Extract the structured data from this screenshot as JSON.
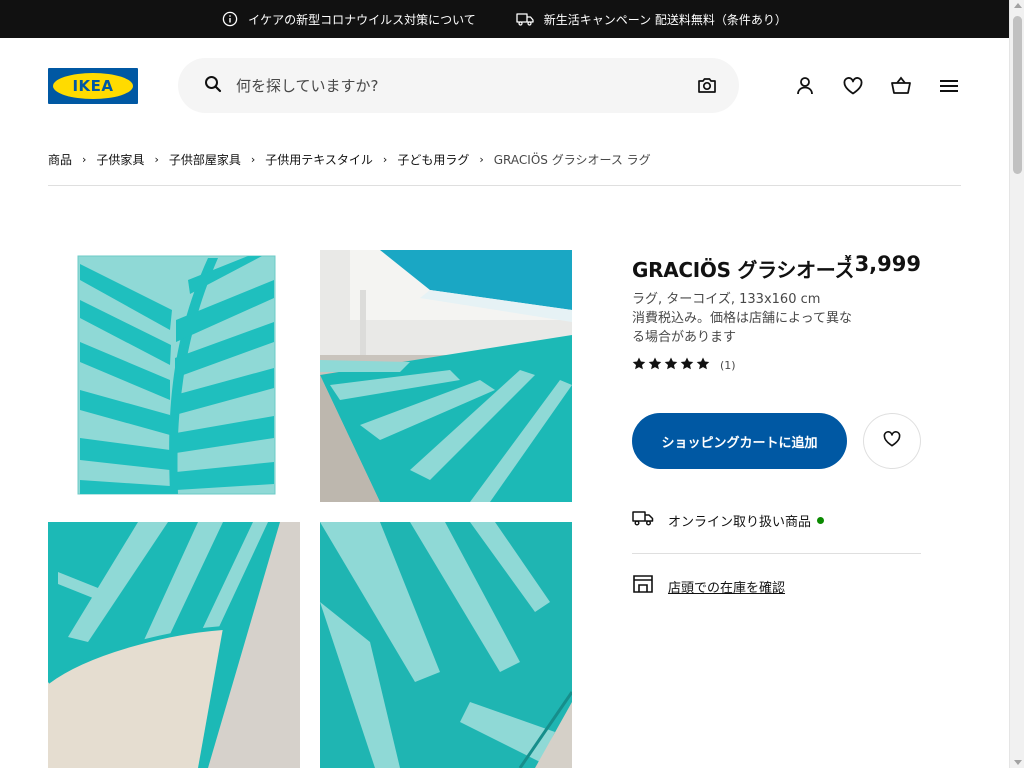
{
  "colors": {
    "brand_blue": "#0058a3",
    "brand_yellow": "#ffdb00",
    "topbar_bg": "#111111",
    "available_green": "#0a8a00",
    "rug_teal": "#1fbfbe",
    "rug_light": "#8fd9d6"
  },
  "topbar": {
    "notice1": {
      "icon": "info-icon",
      "text": "イケアの新型コロナウイルス対策について"
    },
    "notice2": {
      "icon": "truck-icon",
      "text": "新生活キャンペーン 配送料無料（条件あり）"
    }
  },
  "header": {
    "logo_text": "IKEA",
    "search": {
      "placeholder": "何を探していますか?",
      "value": "",
      "icon": "search-icon",
      "camera_icon": "camera-icon"
    },
    "icons": [
      "user-icon",
      "heart-icon",
      "cart-icon",
      "menu-icon"
    ]
  },
  "breadcrumb": [
    "商品",
    "子供家具",
    "子供部屋家具",
    "子供用テキスタイル",
    "子ども用ラグ",
    "GRACIÖS グラシオース ラグ"
  ],
  "product": {
    "name": "GRACIÖS グラシオース",
    "currency": "¥",
    "price": "3,999",
    "description": "ラグ, ターコイズ, 133x160 cm",
    "tax_note": "消費税込み。価格は店舗によって異なる場合があります",
    "rating": {
      "stars": 5,
      "count_text": "(1)"
    },
    "add_to_cart": "ショッピングカートに追加",
    "availability": {
      "icon": "truck-icon",
      "text": "オンライン取り扱い商品",
      "status": "available"
    },
    "store_check": {
      "icon": "store-icon",
      "text": "店頭での在庫を確認"
    }
  },
  "gallery": [
    {
      "icon": "rug-front-image"
    },
    {
      "icon": "rug-bedroom-image"
    },
    {
      "icon": "rug-corner-folded-image"
    },
    {
      "icon": "rug-closeup-image"
    }
  ]
}
